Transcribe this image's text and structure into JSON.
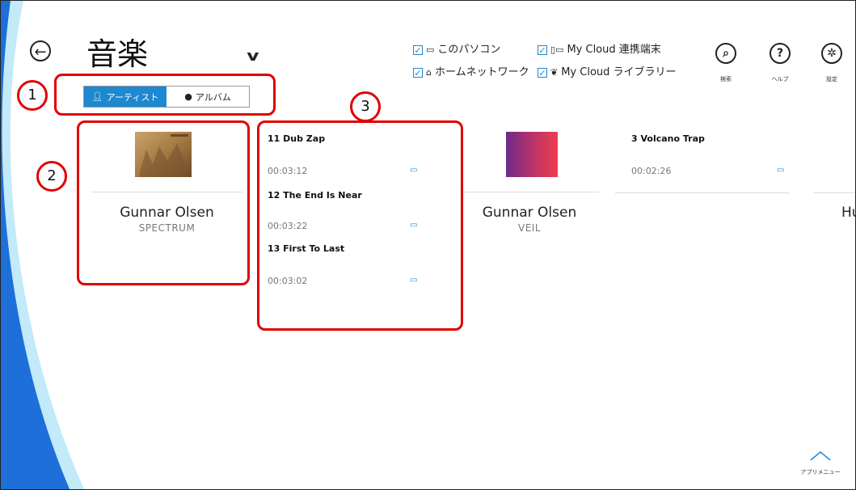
{
  "header": {
    "back_icon": "back-arrow-icon",
    "title": "音楽",
    "title_dropdown_icon": "chevron-down-icon"
  },
  "sources": [
    {
      "label": "このパソコン",
      "checked": true,
      "icon": "computer-icon"
    },
    {
      "label": "My Cloud 連携端末",
      "checked": true,
      "icon": "linked-device-icon"
    },
    {
      "label": "ホームネットワーク",
      "checked": true,
      "icon": "home-network-icon"
    },
    {
      "label": "My Cloud ライブラリー",
      "checked": true,
      "icon": "cloud-library-icon"
    }
  ],
  "top_buttons": [
    {
      "caption": "検索",
      "icon": "search-icon",
      "glyph": "🔍"
    },
    {
      "caption": "ヘルプ",
      "icon": "help-icon",
      "glyph": "?"
    },
    {
      "caption": "設定",
      "icon": "gear-icon",
      "glyph": "✲"
    }
  ],
  "view_toggle": {
    "artist_label": "アーティスト",
    "album_label": "アルバム",
    "selected": "artist"
  },
  "callouts": [
    "1",
    "2",
    "3"
  ],
  "albums": [
    {
      "artist": "Gunnar Olsen",
      "album": "SPECTRUM",
      "cover_text": "SPECTRUM"
    },
    {
      "artist": "Gunnar Olsen",
      "album": "VEIL"
    },
    {
      "artist": "Hu"
    }
  ],
  "tracks_col1": [
    {
      "title": "11 Dub Zap",
      "time": "00:03:12"
    },
    {
      "title": "12 The End Is Near",
      "time": "00:03:22"
    },
    {
      "title": "13 First To Last",
      "time": "00:03:02"
    }
  ],
  "tracks_col2": [
    {
      "title": "3 Volcano Trap",
      "time": "00:02:26"
    }
  ],
  "app_menu": {
    "label": "アプリメニュー"
  },
  "colors": {
    "accent": "#1e88d0",
    "annotation": "#e00000",
    "swoosh": "#1e6fd9"
  }
}
